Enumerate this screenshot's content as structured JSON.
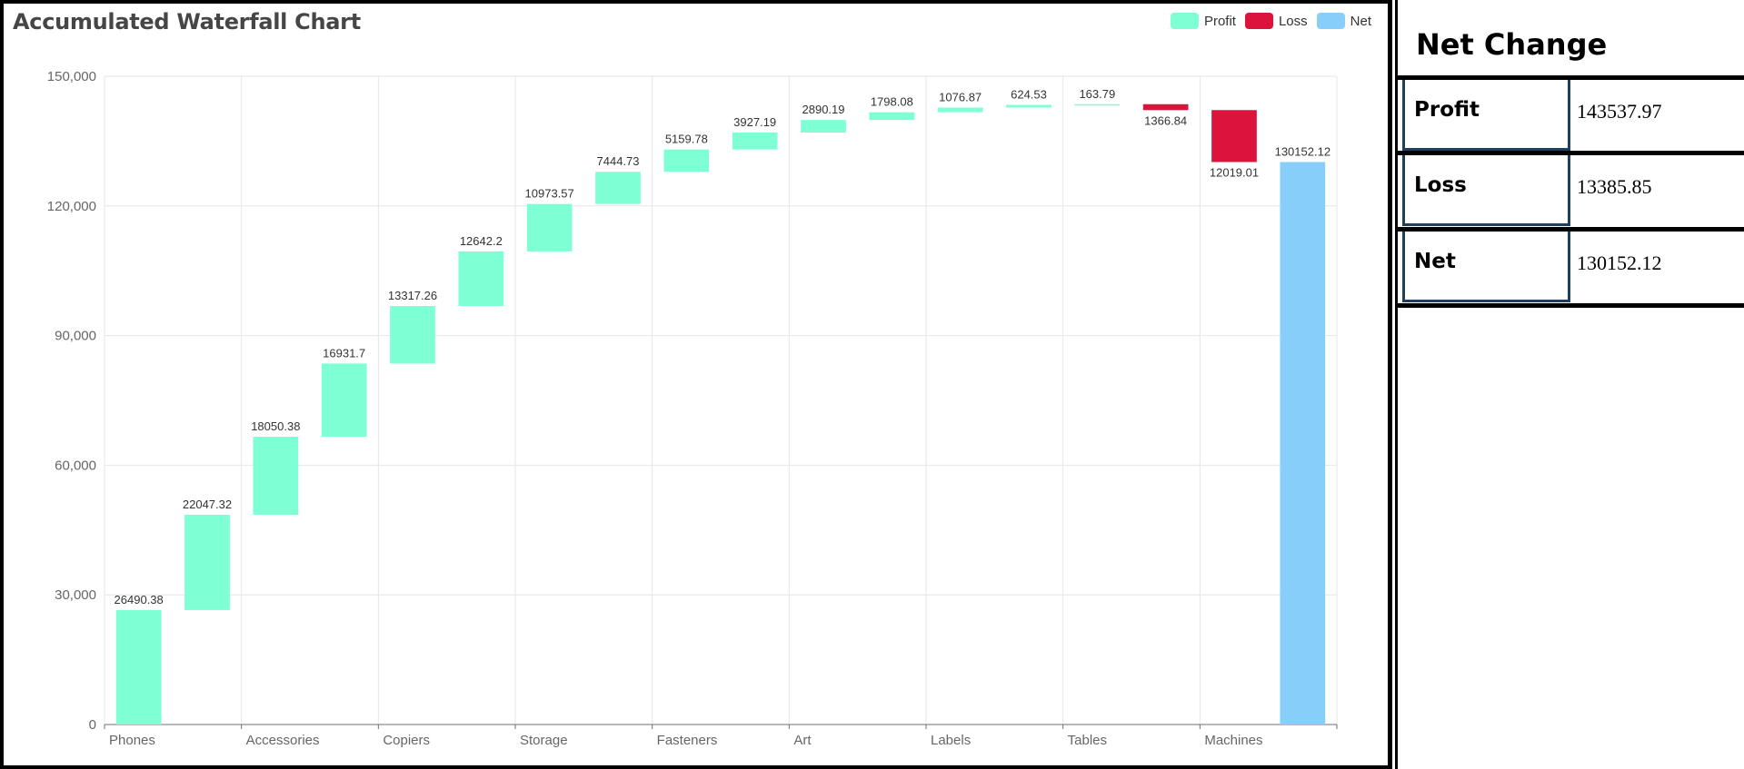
{
  "chart": {
    "title": "Accumulated Waterfall Chart",
    "legend": [
      {
        "label": "Profit",
        "color": "#7fffd4"
      },
      {
        "label": "Loss",
        "color": "#dc143c"
      },
      {
        "label": "Net",
        "color": "#87cefa"
      }
    ]
  },
  "chart_data": {
    "type": "bar",
    "subtype": "waterfall",
    "title": "Accumulated Waterfall Chart",
    "ylim": [
      0,
      150000
    ],
    "y_ticks": [
      "0",
      "30,000",
      "60,000",
      "90,000",
      "120,000",
      "150,000"
    ],
    "y_tick_values": [
      0,
      30000,
      60000,
      90000,
      120000,
      150000
    ],
    "x_tick_labels": [
      "Phones",
      "Accessories",
      "Copiers",
      "Storage",
      "Fasteners",
      "Art",
      "Labels",
      "Tables",
      "Machines"
    ],
    "grid": true,
    "legend_position": "top-right",
    "bars": [
      {
        "label": "26490.38",
        "start": 0,
        "end": 26490.38,
        "kind": "Profit"
      },
      {
        "label": "22047.32",
        "start": 26490.38,
        "end": 48537.7,
        "kind": "Profit"
      },
      {
        "label": "18050.38",
        "start": 48537.7,
        "end": 66588.08,
        "kind": "Profit"
      },
      {
        "label": "16931.7",
        "start": 66588.08,
        "end": 83519.78,
        "kind": "Profit"
      },
      {
        "label": "13317.26",
        "start": 83519.78,
        "end": 96837.04,
        "kind": "Profit"
      },
      {
        "label": "12642.2",
        "start": 96837.04,
        "end": 109479.24,
        "kind": "Profit"
      },
      {
        "label": "10973.57",
        "start": 109479.24,
        "end": 120452.81,
        "kind": "Profit"
      },
      {
        "label": "7444.73",
        "start": 120452.81,
        "end": 127897.54,
        "kind": "Profit"
      },
      {
        "label": "5159.78",
        "start": 127897.54,
        "end": 133057.32,
        "kind": "Profit"
      },
      {
        "label": "3927.19",
        "start": 133057.32,
        "end": 136984.51,
        "kind": "Profit"
      },
      {
        "label": "2890.19",
        "start": 136984.51,
        "end": 139874.7,
        "kind": "Profit"
      },
      {
        "label": "1798.08",
        "start": 139874.7,
        "end": 141672.78,
        "kind": "Profit"
      },
      {
        "label": "1076.87",
        "start": 141672.78,
        "end": 142749.65,
        "kind": "Profit"
      },
      {
        "label": "624.53",
        "start": 142749.65,
        "end": 143374.18,
        "kind": "Profit"
      },
      {
        "label": "163.79",
        "start": 143374.18,
        "end": 143537.97,
        "kind": "Profit"
      },
      {
        "label": "1366.84",
        "start": 142171.13,
        "end": 143537.97,
        "kind": "Loss"
      },
      {
        "label": "12019.01",
        "start": 130152.12,
        "end": 142171.13,
        "kind": "Loss"
      },
      {
        "label": "130152.12",
        "start": 0,
        "end": 130152.12,
        "kind": "Net"
      }
    ]
  },
  "side": {
    "title": "Net Change",
    "rows": [
      {
        "label": "Profit",
        "value": "143537.97"
      },
      {
        "label": "Loss",
        "value": "13385.85"
      },
      {
        "label": "Net",
        "value": "130152.12"
      }
    ]
  }
}
